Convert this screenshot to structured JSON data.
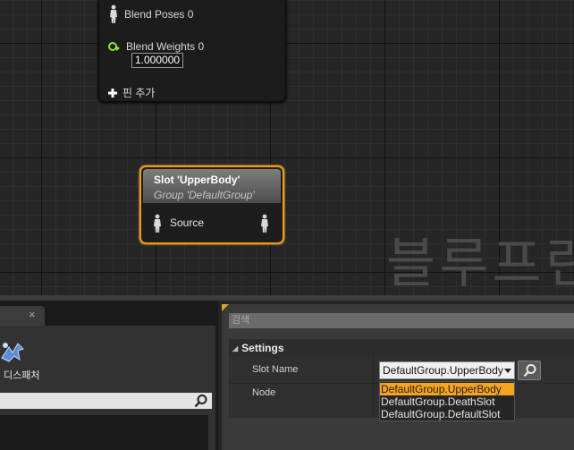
{
  "graph": {
    "node_partial": {
      "pin_blend_poses": "Blend Poses 0",
      "pin_blend_weights": "Blend Weights 0",
      "blend_weight_value": "1.000000",
      "add_pin_label": "핀 추가"
    },
    "slot_node": {
      "title": "Slot 'UpperBody'",
      "subtitle": "Group 'DefaultGroup'",
      "input_pin": "Source"
    },
    "watermark": "블루프린"
  },
  "left_panel": {
    "tab_close": "×",
    "dispatcher_label": "디스패처"
  },
  "details": {
    "search_placeholder": "검색",
    "section_title": "Settings",
    "slot_name_label": "Slot Name",
    "node_label": "Node",
    "slot_name_value": "DefaultGroup.UpperBody",
    "options": [
      "DefaultGroup.UpperBody",
      "DefaultGroup.DeathSlot",
      "DefaultGroup.DefaultSlot"
    ]
  },
  "colors": {
    "node_selected_border": "#f29b1a",
    "option_highlight": "#f6a41e",
    "float_pin": "#8fe32b"
  },
  "icons": [
    "person-pin-icon",
    "float-pin-icon",
    "plus-icon",
    "search-icon",
    "dispatcher-icon",
    "collapse-triangle-icon",
    "dropdown-arrow-icon"
  ]
}
